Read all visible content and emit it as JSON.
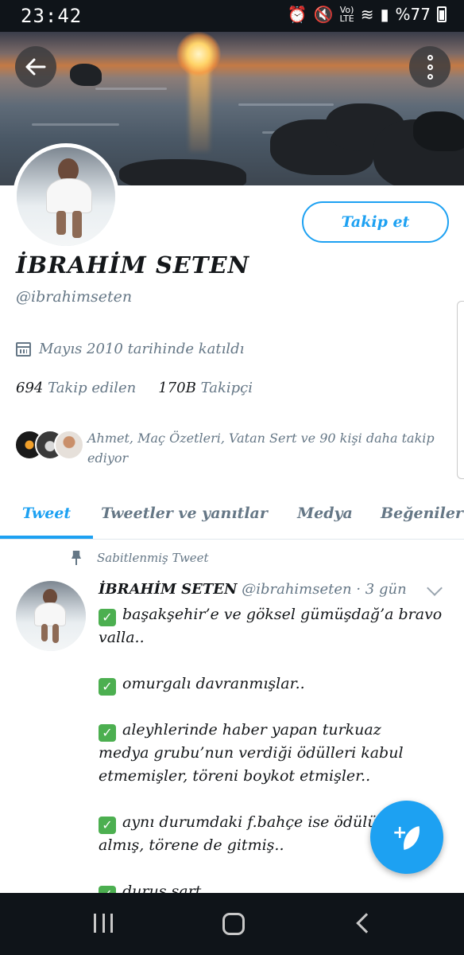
{
  "status_bar": {
    "time": "23:42",
    "volte": "Vo)",
    "lte": "LTE",
    "battery": "%77"
  },
  "profile": {
    "follow_label": "Takip et",
    "name": "İBRAHİM SETEN",
    "handle": "@ibrahimseten",
    "joined": "Mayıs 2010 tarihinde katıldı",
    "following_count": "694",
    "following_label": "Takip edilen",
    "followers_count": "170B",
    "followers_label": "Takipçi",
    "followed_by": "Ahmet, Maç Özetleri, Vatan Sert ve 90 kişi daha takip ediyor"
  },
  "tabs": [
    {
      "label": "Tweet",
      "active": true
    },
    {
      "label": "Tweetler ve yanıtlar",
      "active": false
    },
    {
      "label": "Medya",
      "active": false
    },
    {
      "label": "Beğeniler",
      "active": false
    }
  ],
  "tweet": {
    "pinned_label": "Sabitlenmiş Tweet",
    "author_name": "İBRAHİM SETEN",
    "author_handle": "@ibrahimseten",
    "time": "· 3 gün",
    "check_glyph": "✓",
    "lines": {
      "p1_l1": "başakşehir’e ve göksel gümüşdağ’a bravo",
      "p1_l2": "valla..",
      "p2_l1": "omurgalı davranmışlar..",
      "p3_l1": "aleyhlerinde haber yapan turkuaz",
      "p3_l2": "medya grubu’nun verdiği ödülleri kabul",
      "p3_l3": "etmemişler, töreni boykot etmişler..",
      "p4_l1": "aynı durumdaki f.bahçe ise ödülü",
      "p4_l2": "almış, törene de gitmiş..",
      "p5_l1": "duruş şart.."
    }
  },
  "colors": {
    "accent": "#1da1f2",
    "secondary_text": "#657786",
    "check_green": "#4caf50"
  },
  "icons": [
    "back-arrow-icon",
    "more-vertical-icon",
    "calendar-icon",
    "pin-icon",
    "chevron-down-icon",
    "compose-tweet-icon"
  ]
}
